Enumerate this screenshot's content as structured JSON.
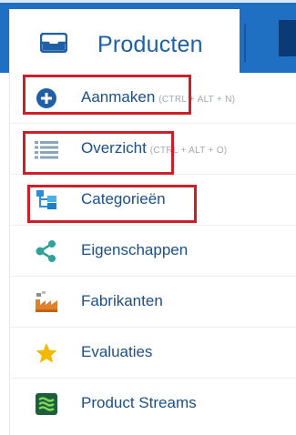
{
  "header": {
    "tab_label": "Producten",
    "tab_icon": "inbox-icon"
  },
  "menu": {
    "items": [
      {
        "label": "Aanmaken",
        "hint": "(CTRL + ALT + N)",
        "icon": "plus-circle-icon"
      },
      {
        "label": "Overzicht",
        "hint": "(CTRL + ALT + O)",
        "icon": "list-icon"
      },
      {
        "label": "Categorieën",
        "hint": "",
        "icon": "tree-icon"
      },
      {
        "label": "Eigenschappen",
        "hint": "",
        "icon": "share-icon"
      },
      {
        "label": "Fabrikanten",
        "hint": "",
        "icon": "factory-icon"
      },
      {
        "label": "Evaluaties",
        "hint": "",
        "icon": "star-icon"
      },
      {
        "label": "Product Streams",
        "hint": "",
        "icon": "stream-icon"
      }
    ]
  },
  "colors": {
    "topbar": "#1f6fc3",
    "label_text": "#1c4f86",
    "highlight_border": "#cc1f2a"
  }
}
